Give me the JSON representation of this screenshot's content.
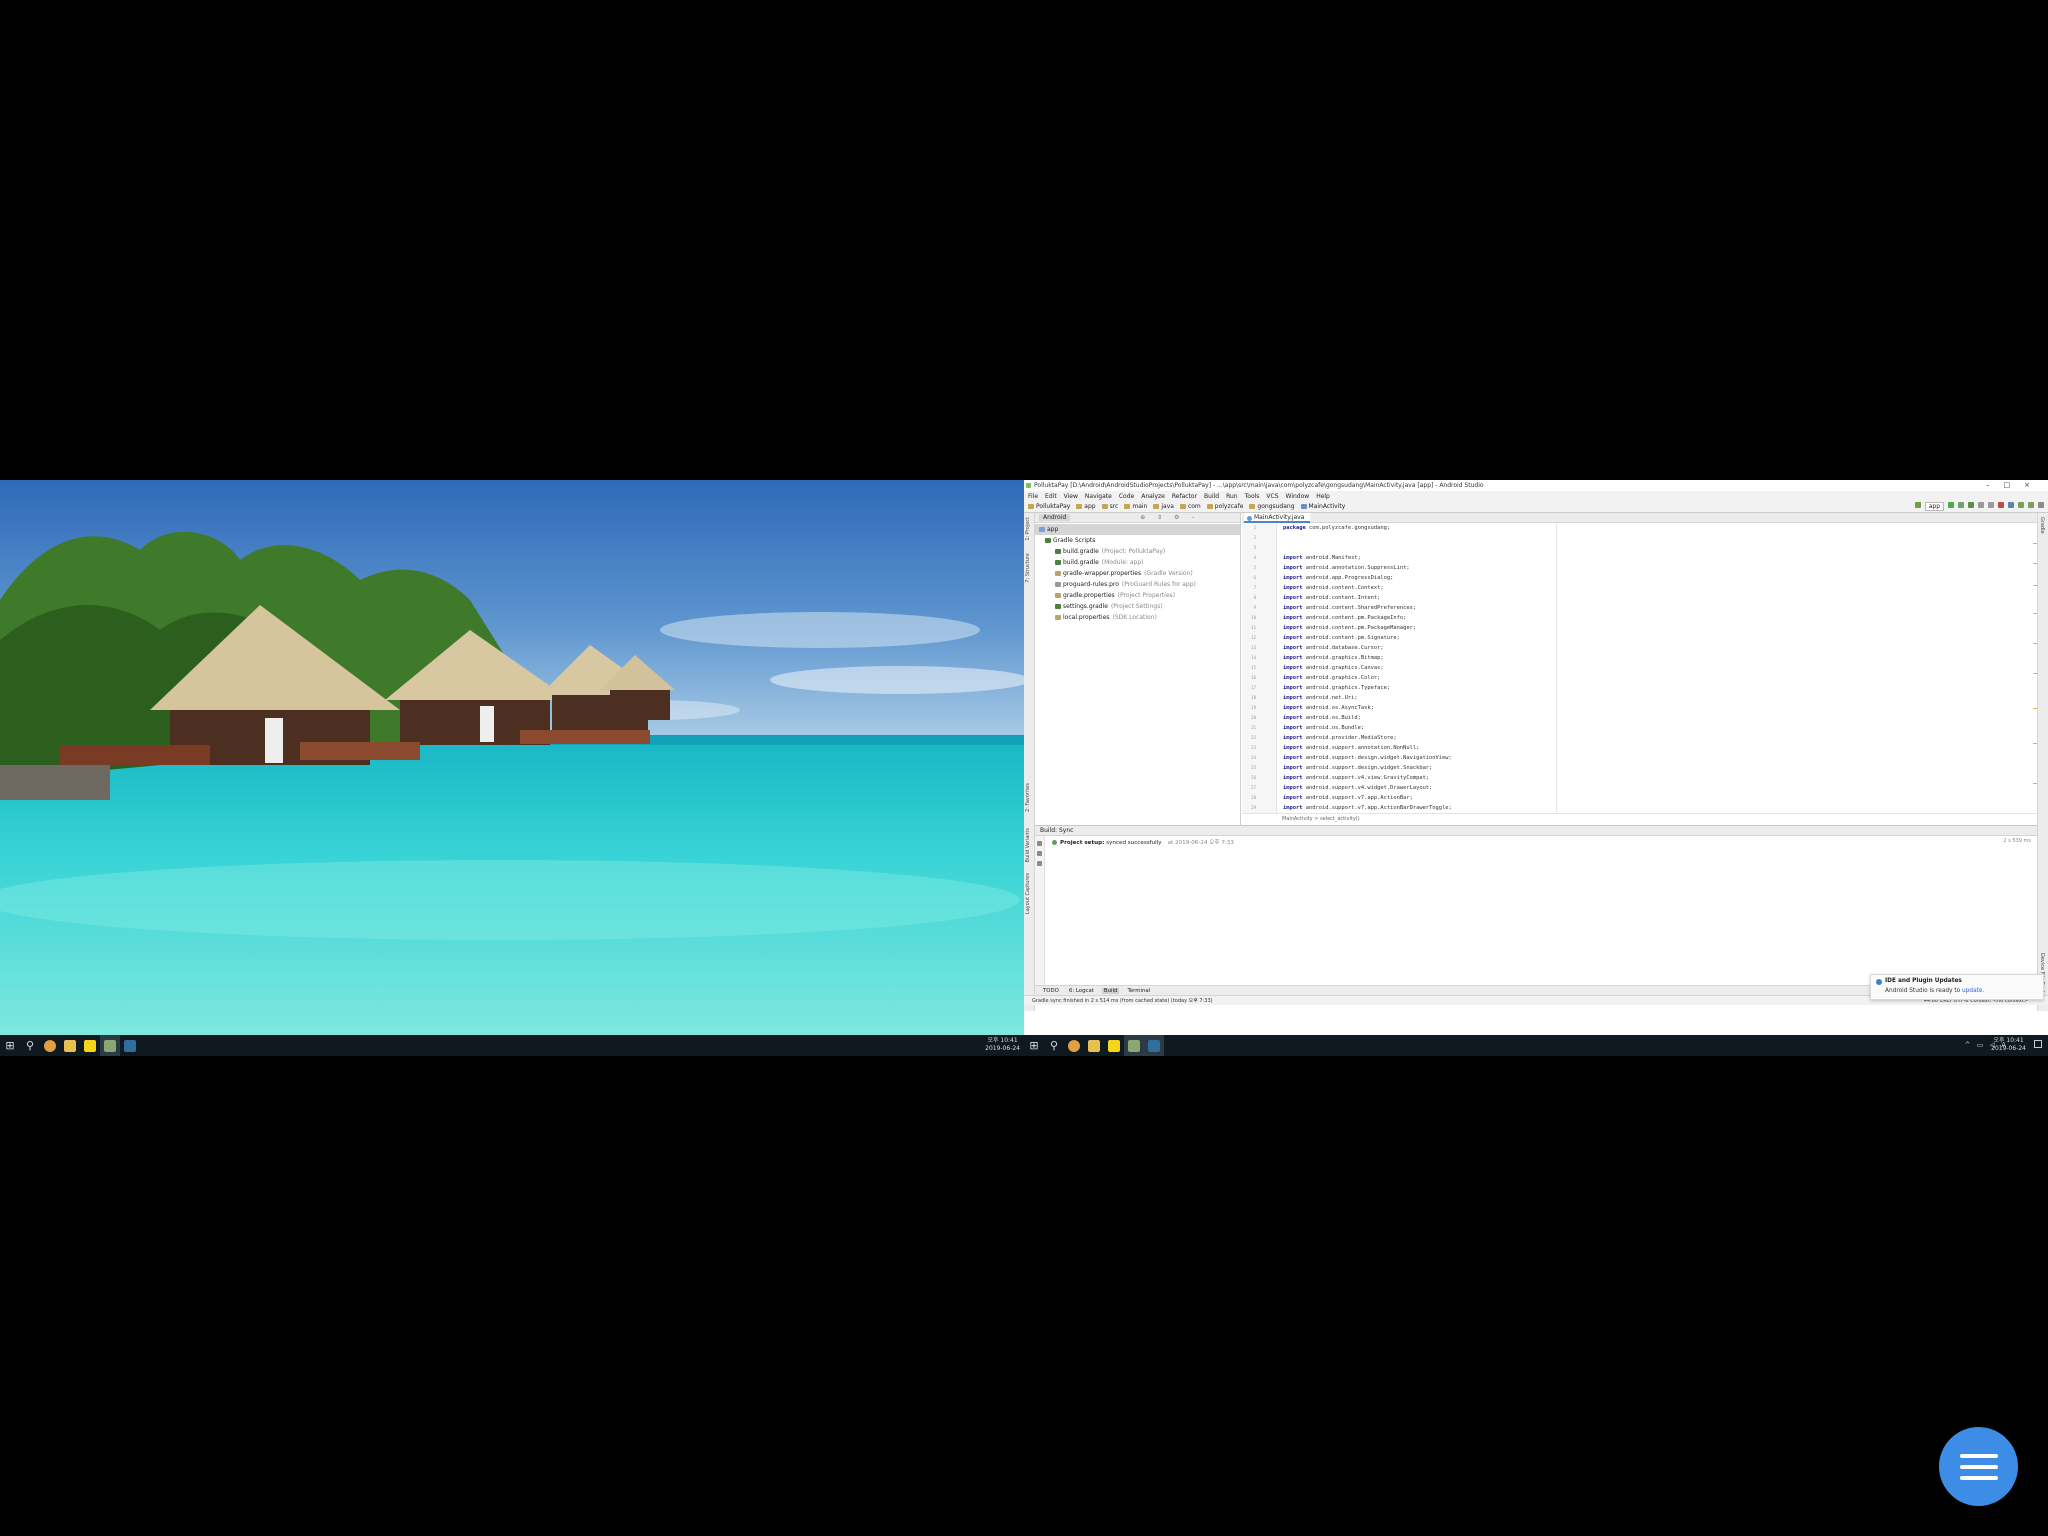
{
  "left_screen": {
    "taskbar": {
      "clock_time": "오후 10:41",
      "clock_date": "2019-06-24"
    }
  },
  "ide": {
    "title": "PolluktaPay [D:\\Android\\AndroidStudioProjects\\PolluktaPay] - ...\\app\\src\\main\\java\\com\\polyzcafe\\gongsudang\\MainActivity.java [app] - Android Studio",
    "menu": [
      "File",
      "Edit",
      "View",
      "Navigate",
      "Code",
      "Analyze",
      "Refactor",
      "Build",
      "Run",
      "Tools",
      "VCS",
      "Window",
      "Help"
    ],
    "nav_crumbs": [
      "PolluktaPay",
      "app",
      "src",
      "main",
      "java",
      "com",
      "polyzcafe",
      "gongsudang",
      "MainActivity"
    ],
    "run_config": "app",
    "project_panel": {
      "view_mode": "Android",
      "tree": [
        {
          "label": "app",
          "hint": ""
        },
        {
          "label": "Gradle Scripts",
          "hint": ""
        },
        {
          "label": "build.gradle",
          "hint": "(Project: PolluktaPay)"
        },
        {
          "label": "build.gradle",
          "hint": "(Module: app)"
        },
        {
          "label": "gradle-wrapper.properties",
          "hint": "(Gradle Version)"
        },
        {
          "label": "proguard-rules.pro",
          "hint": "(ProGuard Rules for app)"
        },
        {
          "label": "gradle.properties",
          "hint": "(Project Properties)"
        },
        {
          "label": "settings.gradle",
          "hint": "(Project Settings)"
        },
        {
          "label": "local.properties",
          "hint": "(SDK Location)"
        }
      ]
    },
    "editor": {
      "tab": "MainActivity.java",
      "lines": [
        {
          "n": "1",
          "kw": "package",
          "rest": " com.polyzcafe.gongsudang;"
        },
        {
          "n": "2",
          "kw": "",
          "rest": ""
        },
        {
          "n": "3",
          "kw": "",
          "rest": ""
        },
        {
          "n": "4",
          "kw": "import",
          "rest": " android.Manifest;"
        },
        {
          "n": "5",
          "kw": "import",
          "rest": " android.annotation.SuppressLint;"
        },
        {
          "n": "6",
          "kw": "import",
          "rest": " android.app.ProgressDialog;"
        },
        {
          "n": "7",
          "kw": "import",
          "rest": " android.content.Context;"
        },
        {
          "n": "8",
          "kw": "import",
          "rest": " android.content.Intent;"
        },
        {
          "n": "9",
          "kw": "import",
          "rest": " android.content.SharedPreferences;"
        },
        {
          "n": "10",
          "kw": "import",
          "rest": " android.content.pm.PackageInfo;"
        },
        {
          "n": "11",
          "kw": "import",
          "rest": " android.content.pm.PackageManager;"
        },
        {
          "n": "12",
          "kw": "import",
          "rest": " android.content.pm.Signature;"
        },
        {
          "n": "13",
          "kw": "import",
          "rest": " android.database.Cursor;"
        },
        {
          "n": "14",
          "kw": "import",
          "rest": " android.graphics.Bitmap;"
        },
        {
          "n": "15",
          "kw": "import",
          "rest": " android.graphics.Canvas;"
        },
        {
          "n": "16",
          "kw": "import",
          "rest": " android.graphics.Color;"
        },
        {
          "n": "17",
          "kw": "import",
          "rest": " android.graphics.Typeface;"
        },
        {
          "n": "18",
          "kw": "import",
          "rest": " android.net.Uri;"
        },
        {
          "n": "19",
          "kw": "import",
          "rest": " android.os.AsyncTask;"
        },
        {
          "n": "20",
          "kw": "import",
          "rest": " android.os.Build;"
        },
        {
          "n": "21",
          "kw": "import",
          "rest": " android.os.Bundle;"
        },
        {
          "n": "22",
          "kw": "import",
          "rest": " android.provider.MediaStore;"
        },
        {
          "n": "23",
          "kw": "import",
          "rest": " android.support.annotation.NonNull;"
        },
        {
          "n": "24",
          "kw": "import",
          "rest": " android.support.design.widget.NavigationView;"
        },
        {
          "n": "25",
          "kw": "import",
          "rest": " android.support.design.widget.Snackbar;"
        },
        {
          "n": "26",
          "kw": "import",
          "rest": " android.support.v4.view.GravityCompat;"
        },
        {
          "n": "27",
          "kw": "import",
          "rest": " android.support.v4.widget.DrawerLayout;"
        },
        {
          "n": "28",
          "kw": "import",
          "rest": " android.support.v7.app.ActionBar;"
        },
        {
          "n": "29",
          "kw": "import",
          "rest": " android.support.v7.app.ActionBarDrawerToggle;"
        }
      ],
      "breadcrumb": "MainActivity  >  select_activity()"
    },
    "build": {
      "header": "Build: Sync",
      "message_bold": "Project setup:",
      "message": " synced successfully",
      "timestamp": "at 2019-06-24 오후 7:33",
      "duration": "2 s 539 ms"
    },
    "bottom_tabs": [
      "TODO",
      "6: Logcat",
      "Build",
      "Terminal"
    ],
    "status": {
      "message": "Gradle sync finished in 2 s 514 ms (from cached state) (today 오후 7:33)",
      "right": "44:60   CRLF   UTF-8   Context: <no context>"
    },
    "notification": {
      "title": "IDE and Plugin Updates",
      "body": "Android Studio is ready to ",
      "link": "update."
    },
    "taskbar": {
      "clock_time": "오후 10:41",
      "clock_date": "2019-06-24"
    }
  },
  "fab": {
    "icon": "menu-icon",
    "color": "#3d8de6"
  }
}
